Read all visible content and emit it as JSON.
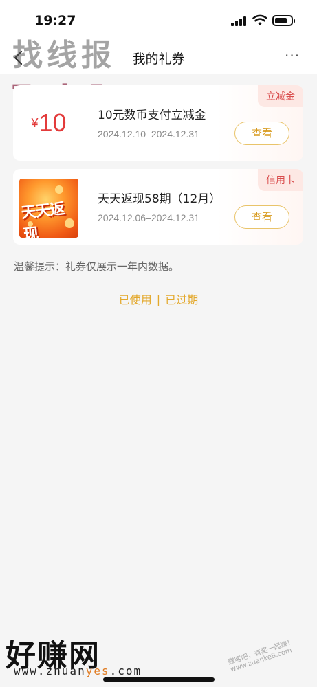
{
  "status": {
    "time": "19:27"
  },
  "nav": {
    "title": "我的礼券",
    "more": "···"
  },
  "watermarks": {
    "top_cn": "找线报",
    "top_url": "Taolu5.com",
    "bottom_cn": "好赚网",
    "bottom_url_pre": "www.zhuan",
    "bottom_url_accent": "yes",
    "bottom_url_post": ".com",
    "stamp": "赚客吧，有奖一起赚！www.zuanke8.com"
  },
  "coupons": [
    {
      "currency": "¥",
      "amount": "10",
      "title": "10元数币支付立减金",
      "date": "2024.12.10–2024.12.31",
      "tag": "立减金",
      "button": "查看"
    },
    {
      "image_text": "天天返现",
      "title": "天天返现58期（12月）",
      "date": "2024.12.06–2024.12.31",
      "tag": "信用卡",
      "button": "查看"
    }
  ],
  "tip": "温馨提示：礼券仅展示一年内数据。",
  "history": {
    "used": "已使用",
    "separator": "|",
    "expired": "已过期"
  },
  "colors": {
    "accent": "#e3a82b",
    "price": "#e33b3b",
    "tag_bg": "#fde8e4"
  }
}
